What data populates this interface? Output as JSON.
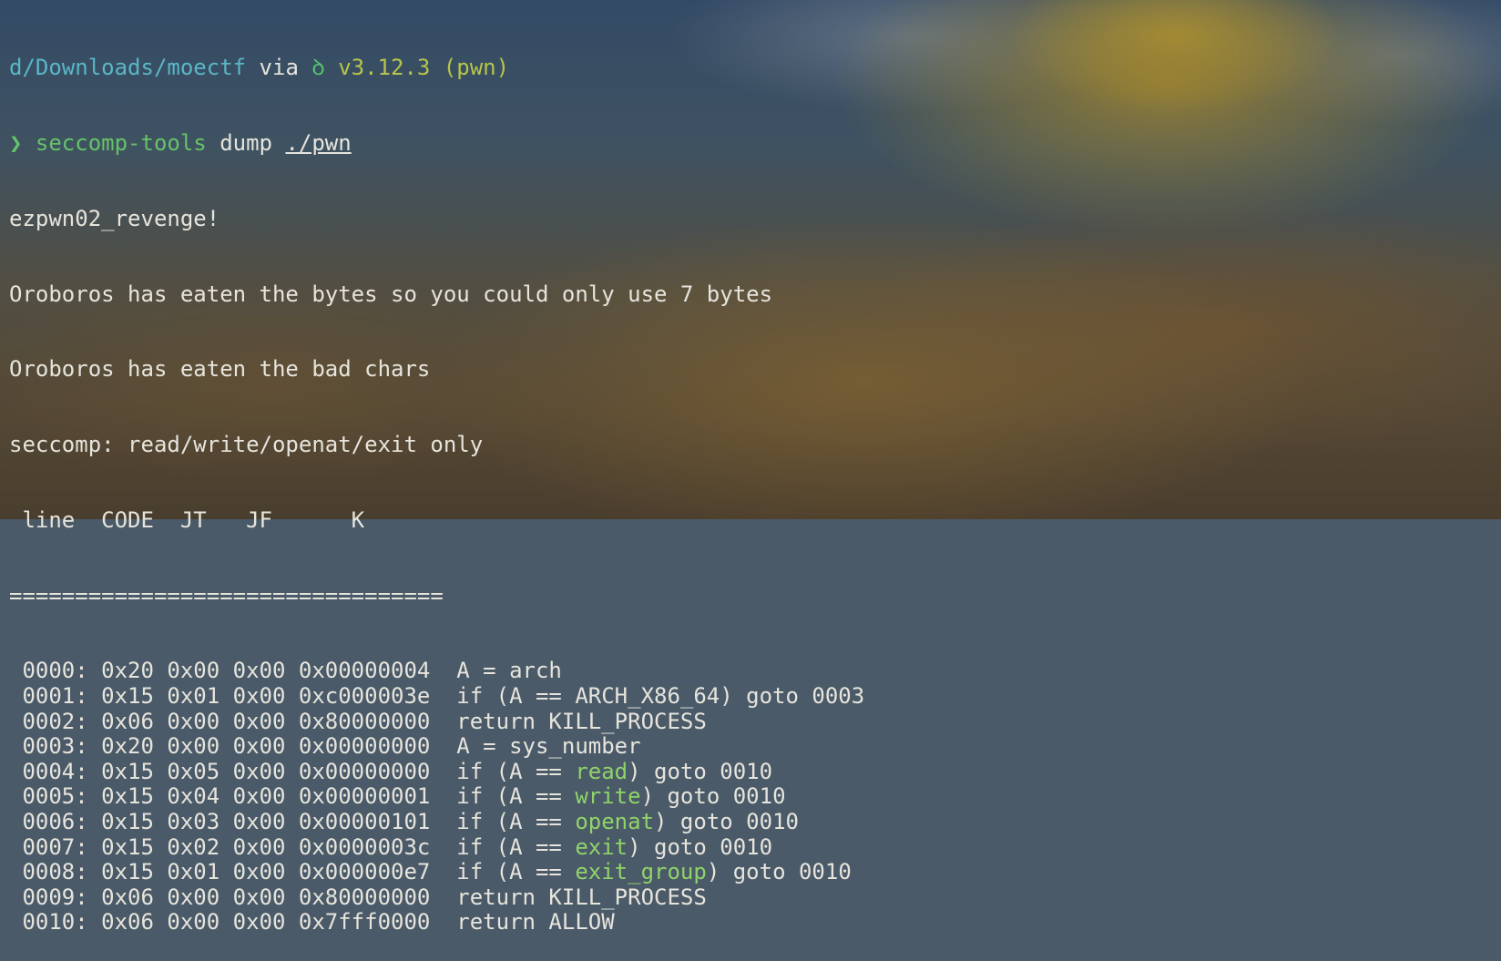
{
  "shell": {
    "cwd": "d/Downloads/moectf",
    "via": "via",
    "python_icon": "python-snake-icon",
    "python_version": "v3.12.3 (pwn)",
    "prompt_char": "❯",
    "command": "seccomp-tools",
    "arg1": "dump",
    "arg2": "./pwn"
  },
  "program_output": [
    "ezpwn02_revenge!",
    "Oroboros has eaten the bytes so you could only use 7 bytes",
    "Oroboros has eaten the bad chars",
    "seccomp: read/write/openat/exit only"
  ],
  "dump": {
    "header": " line  CODE  JT   JF      K",
    "separator": "=================================",
    "rows": [
      {
        "pre": " 0000: 0x20 0x00 0x00 0x00000004  A = arch",
        "sys": "",
        "post": ""
      },
      {
        "pre": " 0001: 0x15 0x01 0x00 0xc000003e  if (A == ARCH_X86_64) goto 0003",
        "sys": "",
        "post": ""
      },
      {
        "pre": " 0002: 0x06 0x00 0x00 0x80000000  return KILL_PROCESS",
        "sys": "",
        "post": ""
      },
      {
        "pre": " 0003: 0x20 0x00 0x00 0x00000000  A = sys_number",
        "sys": "",
        "post": ""
      },
      {
        "pre": " 0004: 0x15 0x05 0x00 0x00000000  if (A == ",
        "sys": "read",
        "post": ") goto 0010"
      },
      {
        "pre": " 0005: 0x15 0x04 0x00 0x00000001  if (A == ",
        "sys": "write",
        "post": ") goto 0010"
      },
      {
        "pre": " 0006: 0x15 0x03 0x00 0x00000101  if (A == ",
        "sys": "openat",
        "post": ") goto 0010"
      },
      {
        "pre": " 0007: 0x15 0x02 0x00 0x0000003c  if (A == ",
        "sys": "exit",
        "post": ") goto 0010"
      },
      {
        "pre": " 0008: 0x15 0x01 0x00 0x000000e7  if (A == ",
        "sys": "exit_group",
        "post": ") goto 0010"
      },
      {
        "pre": " 0009: 0x06 0x00 0x00 0x80000000  return KILL_PROCESS",
        "sys": "",
        "post": ""
      },
      {
        "pre": " 0010: 0x06 0x00 0x00 0x7fff0000  return ALLOW",
        "sys": "",
        "post": ""
      }
    ]
  },
  "colors": {
    "path": "#5ab7c7",
    "prompt": "#67c26b",
    "python_version": "#b7c54a",
    "syscall_highlight": "#8fd36a",
    "text": "#e6e4dc"
  }
}
